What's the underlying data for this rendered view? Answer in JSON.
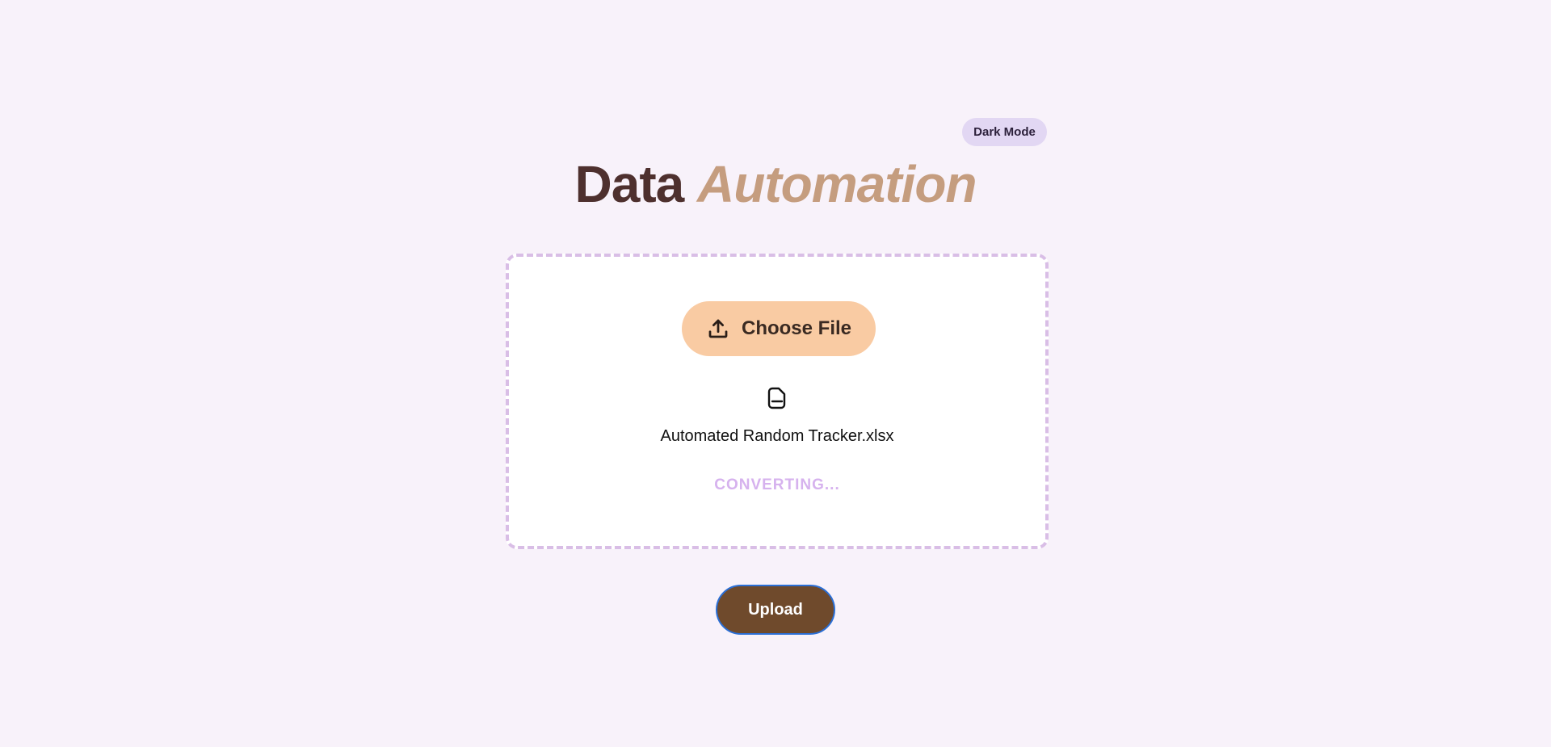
{
  "header": {
    "dark_mode_label": "Dark Mode",
    "title_part1": "Data",
    "title_part2": "Automation"
  },
  "dropzone": {
    "choose_file_label": "Choose File",
    "choose_file_icon": "upload-icon",
    "file_icon": "file-icon",
    "file_name": "Automated Random Tracker.xlsx",
    "status": "CONVERTING..."
  },
  "actions": {
    "upload_label": "Upload"
  },
  "colors": {
    "background": "#f8f2fa",
    "title_primary": "#4e302e",
    "title_accent": "#c59d7f",
    "choose_button": "#f9cba3",
    "upload_button": "#6f4a2c",
    "status_text": "#d6b2ee",
    "dropzone_border": "#d9bee6"
  }
}
